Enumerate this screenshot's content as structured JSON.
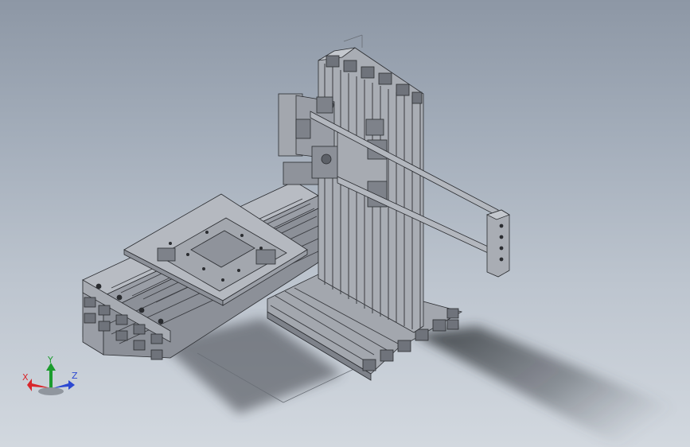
{
  "viewport": {
    "background_top": "#8d97a5",
    "background_bottom": "#d2d8df"
  },
  "model": {
    "view": "isometric",
    "part_color": "#9a9ea6",
    "edge_color": "#2a2c30",
    "shadow_color": "#3d4147"
  },
  "triad": {
    "x_label": "X",
    "y_label": "Y",
    "z_label": "Z",
    "x_color": "#d9262b",
    "y_color": "#1c9c2e",
    "z_color": "#2d49d1"
  }
}
